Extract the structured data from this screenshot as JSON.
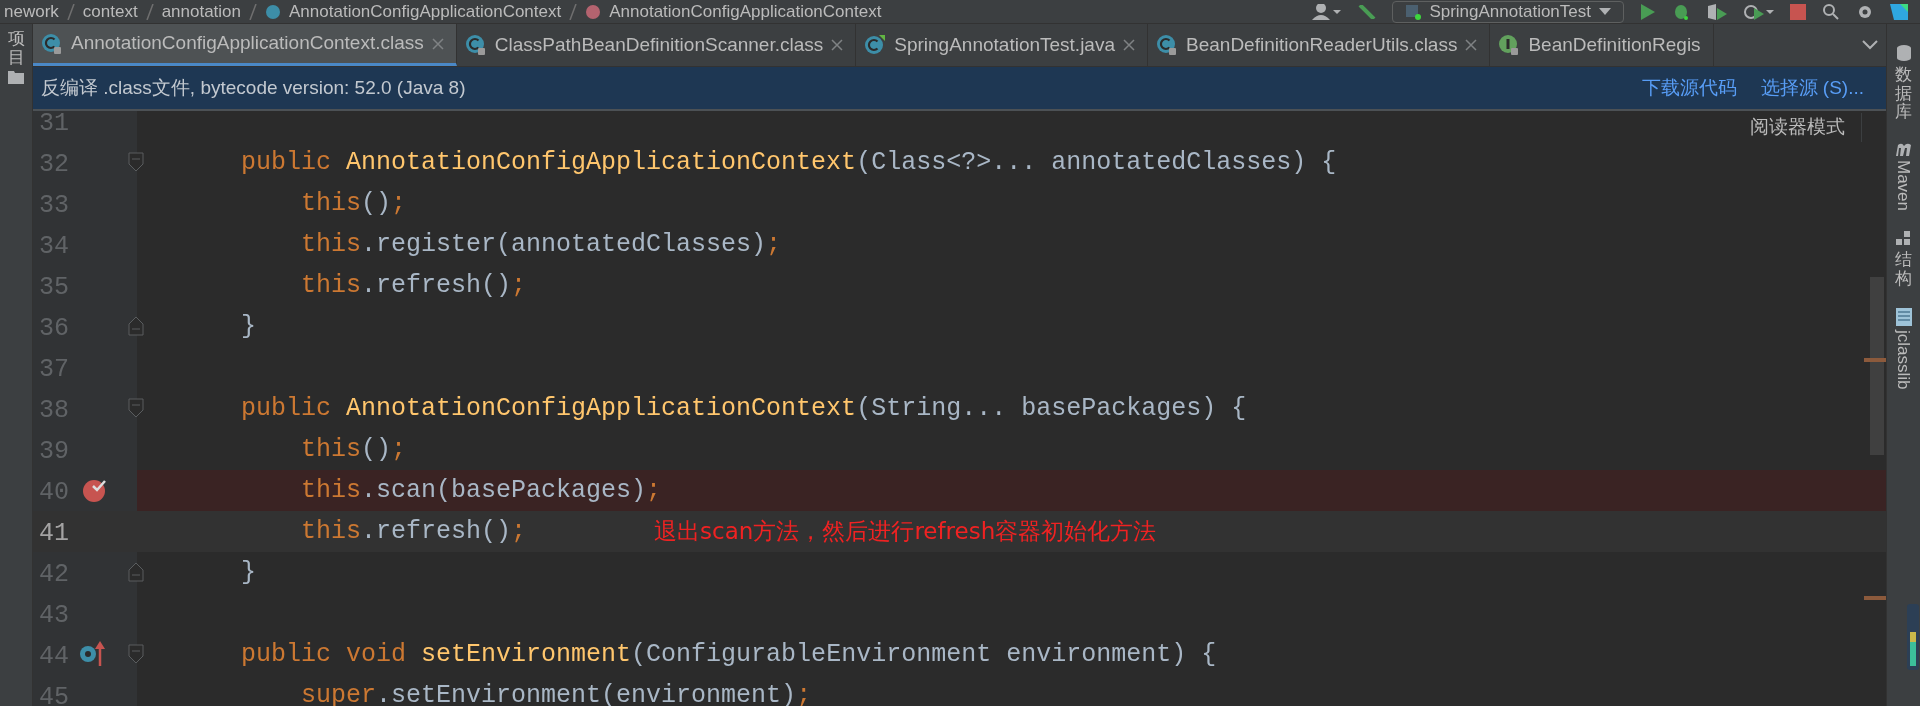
{
  "breadcrumbs": [
    {
      "label": "nework",
      "kind": "package"
    },
    {
      "label": "context",
      "kind": "package"
    },
    {
      "label": "annotation",
      "kind": "package"
    },
    {
      "label": "AnnotationConfigApplicationContext",
      "kind": "class"
    },
    {
      "label": "AnnotationConfigApplicationContext",
      "kind": "method"
    }
  ],
  "run_config": {
    "label": "SpringAnnotationTest"
  },
  "tabs": [
    {
      "label": "AnnotationConfigApplicationContext.class",
      "selected": true,
      "kind": "class",
      "closable": true
    },
    {
      "label": "ClassPathBeanDefinitionScanner.class",
      "selected": false,
      "kind": "class",
      "closable": true
    },
    {
      "label": "SpringAnnotationTest.java",
      "selected": false,
      "kind": "java",
      "closable": true
    },
    {
      "label": "BeanDefinitionReaderUtils.class",
      "selected": false,
      "kind": "class",
      "closable": true
    },
    {
      "label": "BeanDefinitionRegis",
      "selected": false,
      "kind": "interface",
      "closable": false
    }
  ],
  "info_bar": {
    "text": "反编译 .class文件, bytecode version: 52.0 (Java 8)",
    "links": [
      "下载源代码",
      "选择源 (S)..."
    ]
  },
  "reader_mode": "阅读器模式",
  "left_toolbar": [
    {
      "label": "项目"
    }
  ],
  "right_toolbar": [
    {
      "label": "数据库",
      "kind": "database"
    },
    {
      "label": "Maven",
      "kind": "maven"
    },
    {
      "label": "结构",
      "kind": "structure"
    },
    {
      "label": "jclasslib",
      "kind": "jclasslib"
    }
  ],
  "lines": [
    {
      "number": "31",
      "kind": "plain",
      "breakpoint": false,
      "current": false,
      "overrides": false
    },
    {
      "number": "32",
      "kind": "fold_start",
      "breakpoint": false,
      "current": false,
      "overrides": false,
      "tokens": [
        {
          "t": "    public ",
          "kind": "keyword"
        },
        {
          "t": "AnnotationConfigApplicationContext",
          "kind": "method"
        },
        {
          "t": "(Class<?>... annotatedClasses) {",
          "kind": "plain"
        }
      ]
    },
    {
      "number": "33",
      "kind": "plain",
      "breakpoint": false,
      "current": false,
      "overrides": false,
      "tokens": [
        {
          "t": "        this",
          "kind": "keyword"
        },
        {
          "t": "()",
          "kind": "plain"
        },
        {
          "t": ";",
          "kind": "keyword"
        }
      ]
    },
    {
      "number": "34",
      "kind": "plain",
      "breakpoint": false,
      "current": false,
      "overrides": false,
      "tokens": [
        {
          "t": "        this",
          "kind": "keyword"
        },
        {
          "t": ".register(annotatedClasses)",
          "kind": "plain"
        },
        {
          "t": ";",
          "kind": "keyword"
        }
      ]
    },
    {
      "number": "35",
      "kind": "plain",
      "breakpoint": false,
      "current": false,
      "overrides": false,
      "tokens": [
        {
          "t": "        this",
          "kind": "keyword"
        },
        {
          "t": ".refresh()",
          "kind": "plain"
        },
        {
          "t": ";",
          "kind": "keyword"
        }
      ]
    },
    {
      "number": "36",
      "kind": "fold_end",
      "breakpoint": false,
      "current": false,
      "overrides": false,
      "tokens": [
        {
          "t": "    }",
          "kind": "plain"
        }
      ]
    },
    {
      "number": "37",
      "kind": "plain",
      "breakpoint": false,
      "current": false,
      "overrides": false
    },
    {
      "number": "38",
      "kind": "fold_start",
      "breakpoint": false,
      "current": false,
      "overrides": false,
      "tokens": [
        {
          "t": "    public ",
          "kind": "keyword"
        },
        {
          "t": "AnnotationConfigApplicationContext",
          "kind": "method"
        },
        {
          "t": "(String... basePackages) {",
          "kind": "plain"
        }
      ]
    },
    {
      "number": "39",
      "kind": "plain",
      "breakpoint": false,
      "current": false,
      "overrides": false,
      "tokens": [
        {
          "t": "        this",
          "kind": "keyword"
        },
        {
          "t": "()",
          "kind": "plain"
        },
        {
          "t": ";",
          "kind": "keyword"
        }
      ]
    },
    {
      "number": "40",
      "kind": "plain",
      "breakpoint": true,
      "current": false,
      "overrides": false,
      "tokens": [
        {
          "t": "        this",
          "kind": "keyword"
        },
        {
          "t": ".scan(basePackages)",
          "kind": "plain"
        },
        {
          "t": ";",
          "kind": "keyword"
        }
      ]
    },
    {
      "number": "41",
      "kind": "plain",
      "breakpoint": false,
      "current": true,
      "overrides": false,
      "tokens": [
        {
          "t": "        this",
          "kind": "keyword"
        },
        {
          "t": ".refresh()",
          "kind": "plain"
        },
        {
          "t": ";",
          "kind": "keyword"
        }
      ],
      "note": "退出scan方法，然后进行refresh容器初始化方法"
    },
    {
      "number": "42",
      "kind": "fold_end",
      "breakpoint": false,
      "current": false,
      "overrides": false,
      "tokens": [
        {
          "t": "    }",
          "kind": "plain"
        }
      ]
    },
    {
      "number": "43",
      "kind": "plain",
      "breakpoint": false,
      "current": false,
      "overrides": false
    },
    {
      "number": "44",
      "kind": "fold_start",
      "breakpoint": false,
      "current": false,
      "overrides": true,
      "tokens": [
        {
          "t": "    public void ",
          "kind": "keyword"
        },
        {
          "t": "setEnvironment",
          "kind": "method"
        },
        {
          "t": "(ConfigurableEnvironment environment) {",
          "kind": "plain"
        }
      ]
    },
    {
      "number": "45",
      "kind": "plain",
      "breakpoint": false,
      "current": false,
      "overrides": false,
      "tokens": [
        {
          "t": "        super",
          "kind": "keyword"
        },
        {
          "t": ".setEnvironment(environment)",
          "kind": "plain"
        },
        {
          "t": ";",
          "kind": "keyword"
        }
      ]
    }
  ]
}
